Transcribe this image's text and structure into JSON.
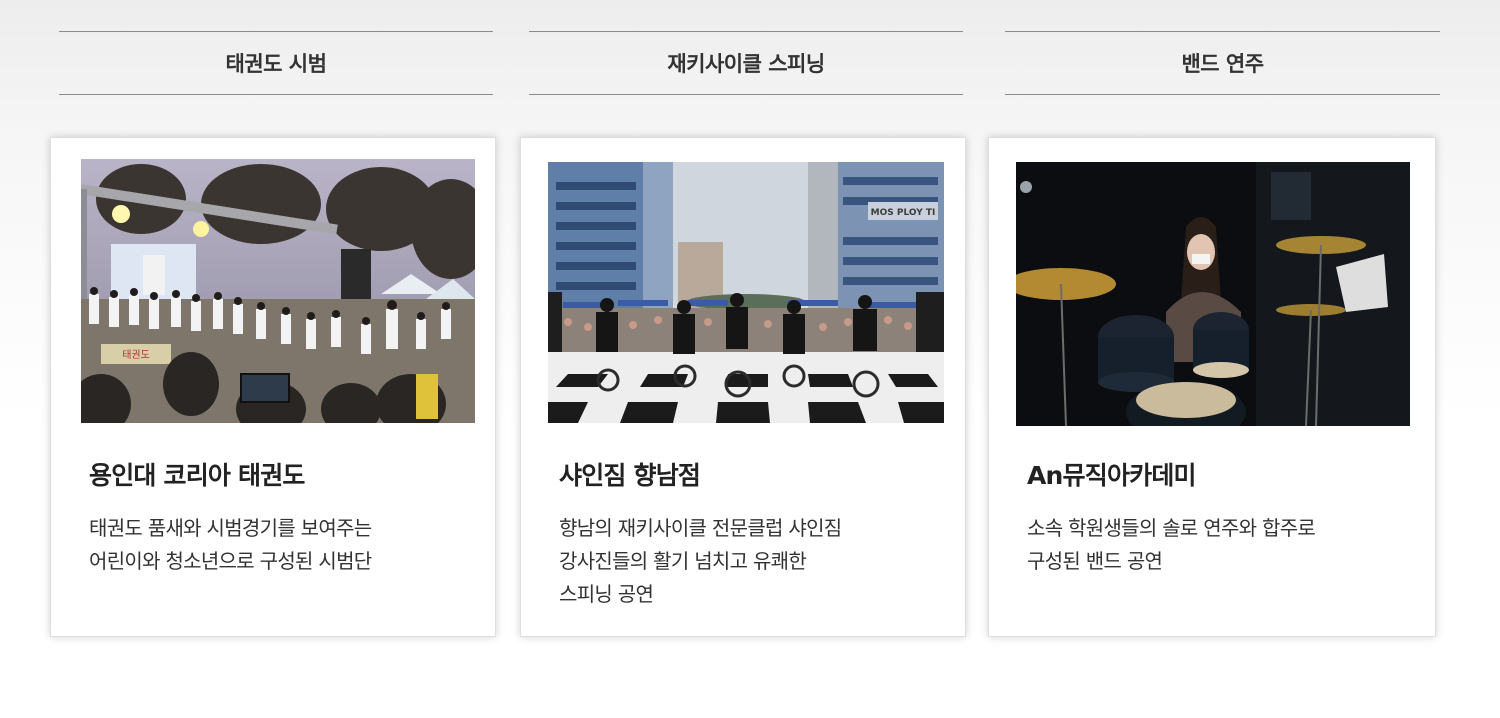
{
  "sections": [
    {
      "heading": "태권도 시범",
      "photo": "taekwondo-demonstration-photo",
      "title": "용인대 코리아 태권도",
      "desc": [
        "태권도 품새와 시범경기를 보여주는",
        "어린이와 청소년으로 구성된 시범단"
      ]
    },
    {
      "heading": "재키사이클 스피닝",
      "photo": "spinning-performance-photo",
      "title": "샤인짐 향남점",
      "desc": [
        "향남의 재키사이클 전문클럽 샤인짐",
        "강사진들의 활기 넘치고 유쾌한",
        "스피닝 공연"
      ]
    },
    {
      "heading": "밴드 연주",
      "photo": "band-drummer-photo",
      "title": "An뮤직아카데미",
      "desc": [
        "소속 학원생들의 솔로 연주와 합주로",
        "구성된 밴드 공연"
      ]
    }
  ],
  "photo_signage": {
    "taekwondo_banner": "태권도",
    "building_sign": "MOS PLOY TI"
  },
  "colors": {
    "rule": "#8c8c8c",
    "text": "#2b2b2b",
    "card_border": "#dedede"
  }
}
